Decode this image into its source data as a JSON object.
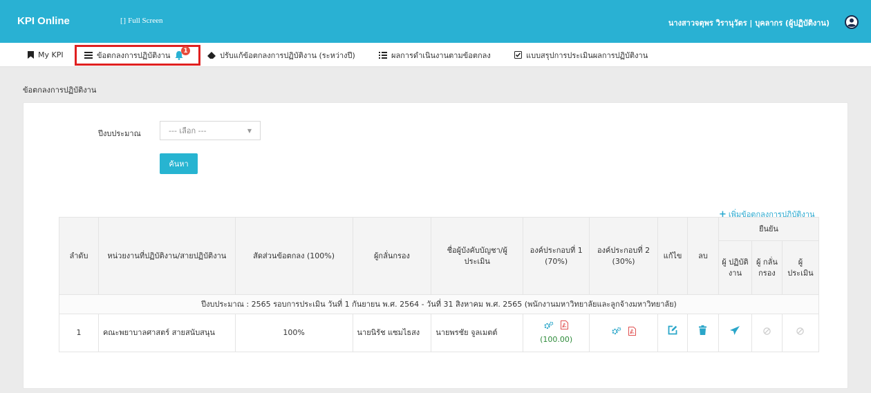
{
  "topbar": {
    "brand": "KPI Online",
    "fullscreen_label": "Full Screen",
    "user_name": "นางสาวจตุพร วิรานุวัตร | บุคลากร (ผู้ปฏิบัติงาน)"
  },
  "nav": {
    "items": [
      {
        "label": "My KPI",
        "icon": "bookmark-icon"
      },
      {
        "label": "ข้อตกลงการปฏิบัติงาน",
        "icon": "list-icon",
        "badge": "1"
      },
      {
        "label": "ปรับแก้ข้อตกลงการปฏิบัติงาน (ระหว่างปี)",
        "icon": "eraser-icon"
      },
      {
        "label": "ผลการดำเนินงานตามข้อตกลง",
        "icon": "list-ol-icon"
      },
      {
        "label": "แบบสรุปการประเมินผลการปฏิบัติงาน",
        "icon": "check-square-icon"
      }
    ]
  },
  "page": {
    "title": "ข้อตกลงการปฏิบัติงาน"
  },
  "filter": {
    "fiscal_year_label": "ปีงบประมาณ",
    "select_value": "--- เลือก ---",
    "search_button": "ค้นหา"
  },
  "add_link": "เพิ่มข้อตกลงการปฏิบัติงาน",
  "table": {
    "headers": {
      "seq": "ลำดับ",
      "unit": "หน่วยงานที่ปฏิบัติงาน/สายปฏิบัติงาน",
      "ratio": "สัดส่วนข้อตกลง (100%)",
      "screener": "ผู้กลั่นกรอง",
      "supervisor": "ชื่อผู้บังคับบัญชา/ผู้ประเมิน",
      "comp1": "องค์ประกอบที่ 1 (70%)",
      "comp2": "องค์ประกอบที่ 2 (30%)",
      "edit": "แก้ไข",
      "delete": "ลบ",
      "confirm": "ยืนยัน",
      "confirm_worker": "ผู้ ปฏิบัติ งาน",
      "confirm_screener": "ผู้ กลั่น กรอง",
      "confirm_evaluator": "ผู้ ประเมิน"
    },
    "group_row": "ปีงบประมาณ : 2565 รอบการประเมิน วันที่ 1 กันยายน พ.ศ. 2564 - วันที่ 31 สิงหาคม พ.ศ. 2565 (พนักงานมหาวิทยาลัยและลูกจ้างมหาวิทยาลัย)",
    "rows": [
      {
        "seq": "1",
        "unit": "คณะพยาบาลศาสตร์ สายสนับสนุน",
        "ratio": "100%",
        "screener": "นายนิรัช แซมไธสง",
        "supervisor": "นายพรชัย จูลเมตต์",
        "comp1_score": "(100.00)"
      }
    ]
  },
  "colors": {
    "topbar": "#29b1d3",
    "highlight": "#e02020",
    "badge": "#e74c3c",
    "accent": "#27b4d1",
    "pdf": "#e05050",
    "score": "#2e8b3a"
  }
}
